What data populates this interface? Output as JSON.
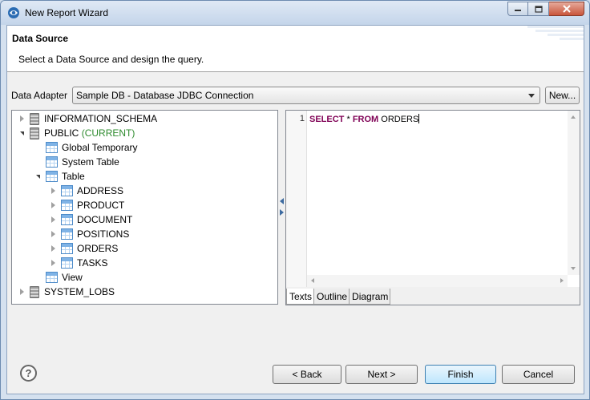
{
  "window": {
    "title": "New Report Wizard",
    "icon": "eclipse-app-icon"
  },
  "header": {
    "title": "Data Source",
    "description": "Select a Data Source and design the query."
  },
  "adapter": {
    "label": "Data Adapter",
    "selected": "Sample DB - Database JDBC Connection",
    "new_label": "New..."
  },
  "tree": {
    "items": [
      {
        "label": "INFORMATION_SCHEMA",
        "icon": "database-icon",
        "expanded": false
      },
      {
        "label": "PUBLIC",
        "suffix": "(CURRENT)",
        "icon": "database-icon",
        "expanded": true
      },
      {
        "label": "Global Temporary",
        "icon": "table-icon"
      },
      {
        "label": "System Table",
        "icon": "table-icon"
      },
      {
        "label": "Table",
        "icon": "table-icon",
        "expanded": true
      },
      {
        "label": "ADDRESS",
        "icon": "table-icon",
        "expanded": false
      },
      {
        "label": "PRODUCT",
        "icon": "table-icon",
        "expanded": false
      },
      {
        "label": "DOCUMENT",
        "icon": "table-icon",
        "expanded": false
      },
      {
        "label": "POSITIONS",
        "icon": "table-icon",
        "expanded": false
      },
      {
        "label": "ORDERS",
        "icon": "table-icon",
        "expanded": false
      },
      {
        "label": "TASKS",
        "icon": "table-icon",
        "expanded": false
      },
      {
        "label": "View",
        "icon": "table-icon"
      },
      {
        "label": "SYSTEM_LOBS",
        "icon": "database-icon",
        "expanded": false
      }
    ]
  },
  "editor": {
    "line_number": "1",
    "kw_select": "SELECT",
    "star": "*",
    "kw_from": "FROM",
    "table": "ORDERS",
    "tabs": [
      "Texts",
      "Outline",
      "Diagram"
    ],
    "active_tab": "Texts"
  },
  "footer": {
    "help_label": "?",
    "back_label": "< Back",
    "next_label": "Next >",
    "finish_label": "Finish",
    "cancel_label": "Cancel"
  },
  "colors": {
    "keyword": "#7f0055",
    "current": "#2e8b2e",
    "title_gradient_top": "#dfe9f5",
    "close_button": "#c9553b"
  }
}
